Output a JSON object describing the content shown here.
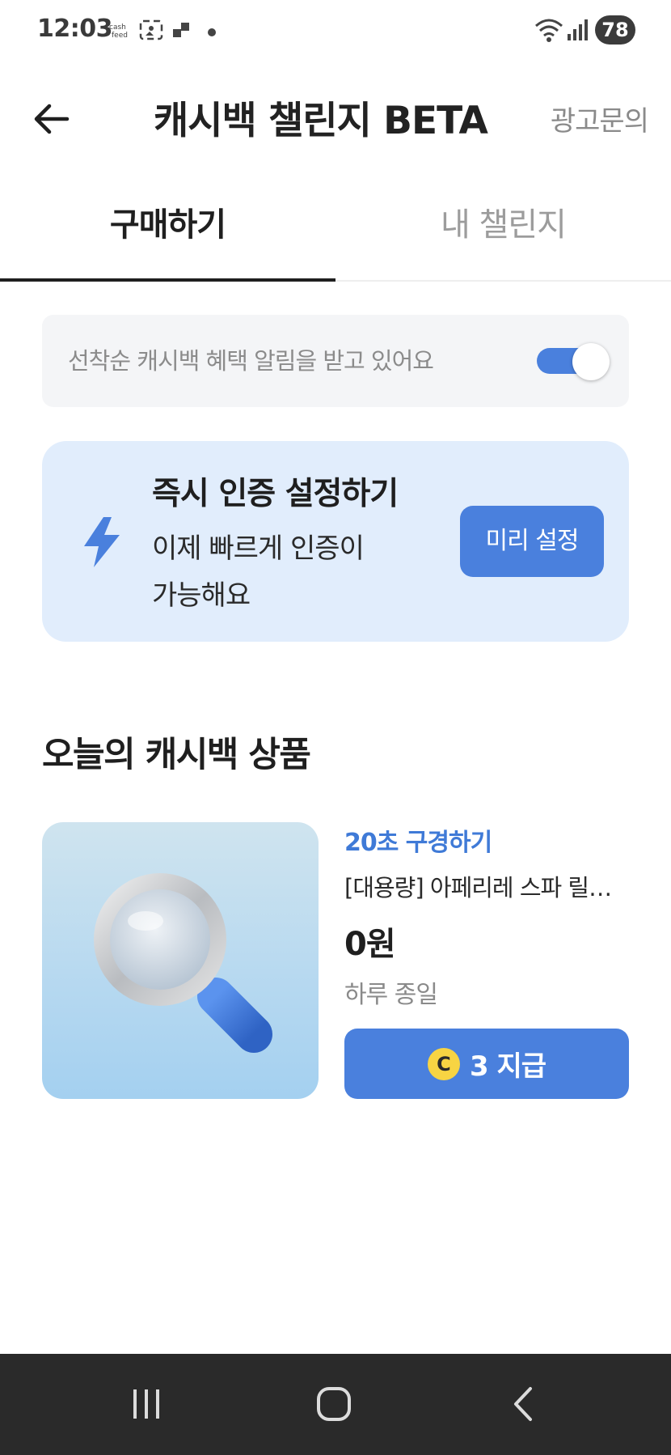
{
  "status_bar": {
    "time": "12:03",
    "battery": "78",
    "icons": [
      "cashfeed-icon",
      "screenshot-icon",
      "app-icon",
      "dot-icon",
      "wifi-icon",
      "signal-icon",
      "battery-icon"
    ]
  },
  "header": {
    "title": "캐시백 챌린지 BETA",
    "ad_inquiry": "광고문의",
    "back_icon": "back-arrow-icon"
  },
  "tabs": [
    {
      "label": "구매하기",
      "active": true
    },
    {
      "label": "내 챌린지",
      "active": false
    }
  ],
  "notification": {
    "text": "선착순 캐시백 혜택 알림을 받고 있어요",
    "toggle_on": true
  },
  "instant_auth": {
    "title": "즉시 인증 설정하기",
    "desc_line1": "이제 빠르게 인증이",
    "desc_line2": "가능해요",
    "button_label": "미리 설정",
    "icon": "lightning-icon"
  },
  "section": {
    "title": "오늘의 캐시백 상품"
  },
  "product": {
    "browse_label": "20초 구경하기",
    "name": "[대용량] 아페리레 스파 릴…",
    "price": "0원",
    "period": "하루 종일",
    "reward_coin": "C",
    "reward_label": "3 지급",
    "thumb_icon": "magnifying-glass-icon"
  },
  "colors": {
    "accent": "#4a80dd",
    "card_bg": "#e1edfc",
    "coin": "#f7d443"
  },
  "nav": {
    "icons": [
      "recent-apps-icon",
      "home-icon",
      "back-icon"
    ]
  }
}
